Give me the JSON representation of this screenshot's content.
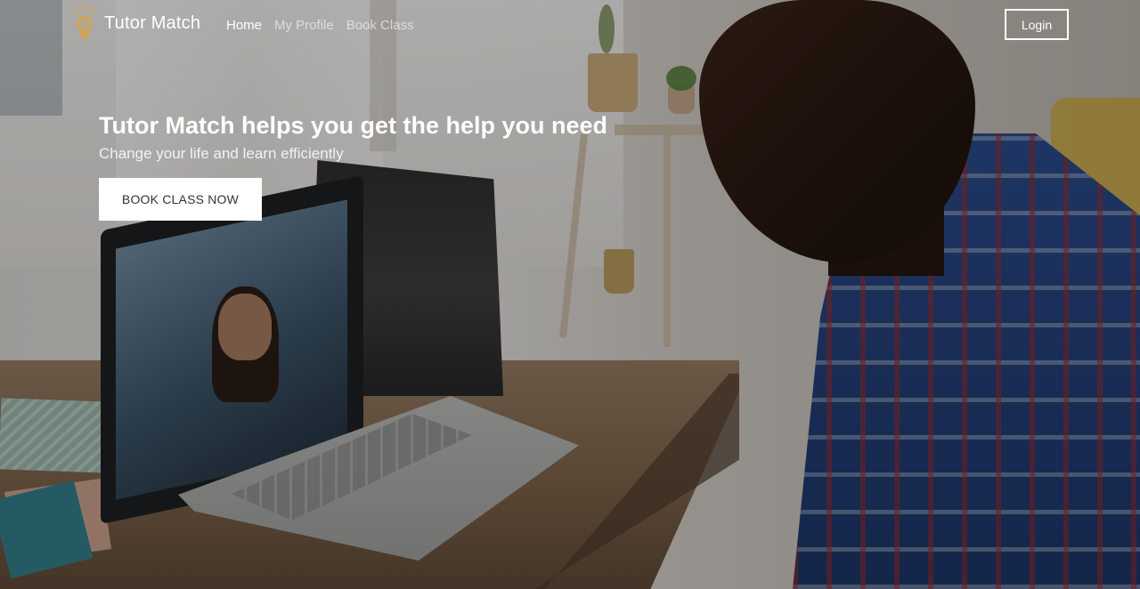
{
  "brand": {
    "name": "Tutor Match",
    "icon": "lightbulb-icon",
    "icon_color": "#e0a03a"
  },
  "nav": {
    "links": [
      {
        "label": "Home",
        "active": true
      },
      {
        "label": "My Profile",
        "active": false
      },
      {
        "label": "Book Class",
        "active": false
      }
    ],
    "login_label": "Login"
  },
  "hero": {
    "title": "Tutor Match helps you get the help you need",
    "subtitle": "Change your life and learn efficiently",
    "cta_label": "BOOK CLASS NOW"
  }
}
